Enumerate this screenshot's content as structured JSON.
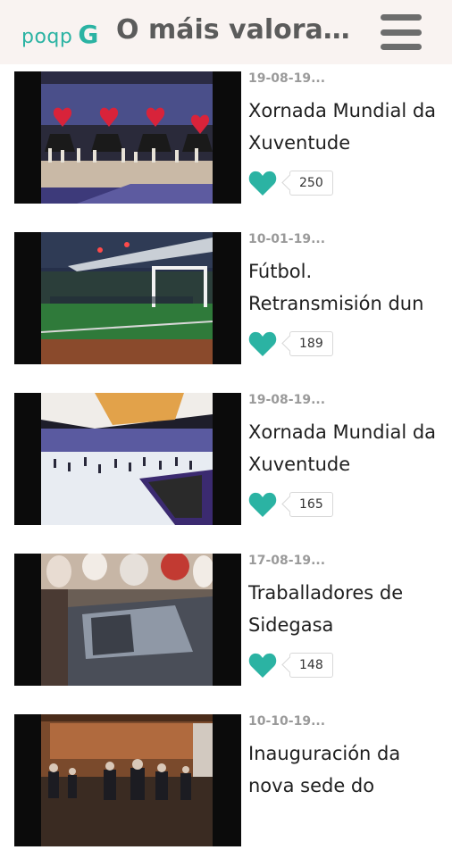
{
  "header": {
    "logo_text": "poqp",
    "logo_mark": "G",
    "title": "O máis valorados"
  },
  "accent_color": "#2bb3a3",
  "items": [
    {
      "date": "19-08-19...",
      "title": "Xornada Mundial da Xuventude",
      "likes": "250",
      "thumb": "stage-hearts"
    },
    {
      "date": "10-01-19...",
      "title": "Fútbol. Retransmisión dun partido",
      "likes": "189",
      "thumb": "football-stadium"
    },
    {
      "date": "19-08-19...",
      "title": "Xornada Mundial da Xuventude",
      "likes": "165",
      "thumb": "arena-dancers"
    },
    {
      "date": "17-08-19...",
      "title": "Traballadores de Sidegasa",
      "likes": "148",
      "thumb": "car-crowd"
    },
    {
      "date": "10-10-19...",
      "title": "Inauguración da nova sede do",
      "likes": "",
      "thumb": "hall-people"
    }
  ]
}
